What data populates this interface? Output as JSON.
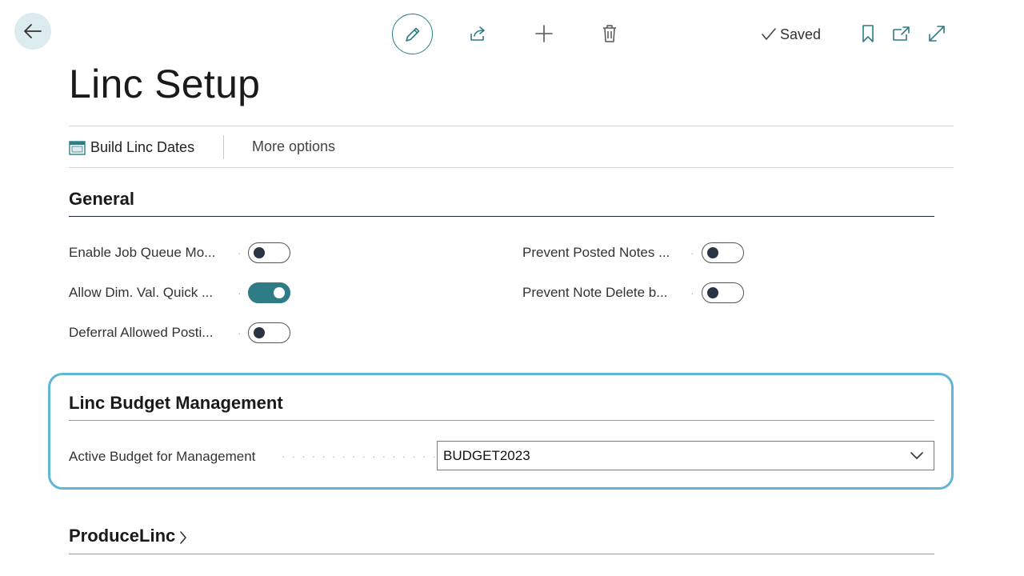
{
  "header": {
    "saved_label": "Saved",
    "icons": [
      "back-arrow-icon",
      "pencil-icon",
      "share-icon",
      "plus-icon",
      "trash-icon",
      "check-icon",
      "bookmark-icon",
      "open-new-window-icon",
      "expand-icon"
    ]
  },
  "page": {
    "title": "Linc Setup"
  },
  "actions": {
    "build_label": "Build Linc Dates",
    "more_label": "More options"
  },
  "general": {
    "title": "General",
    "fields": [
      {
        "label": "Enable Job Queue Mo...",
        "enabled": false
      },
      {
        "label": "Allow Dim. Val. Quick ...",
        "enabled": true
      },
      {
        "label": "Deferral Allowed Posti...",
        "enabled": false
      },
      {
        "label": "Prevent Posted Notes ...",
        "enabled": false
      },
      {
        "label": "Prevent Note Delete b...",
        "enabled": false
      }
    ]
  },
  "budget": {
    "title": "Linc Budget Management",
    "active_label": "Active Budget for Management",
    "active_value": "BUDGET2023"
  },
  "produce": {
    "title": "ProduceLinc"
  },
  "colors": {
    "accent": "#2d7c86",
    "highlight": "#5fb6d6",
    "back_bg": "#dcebee"
  }
}
